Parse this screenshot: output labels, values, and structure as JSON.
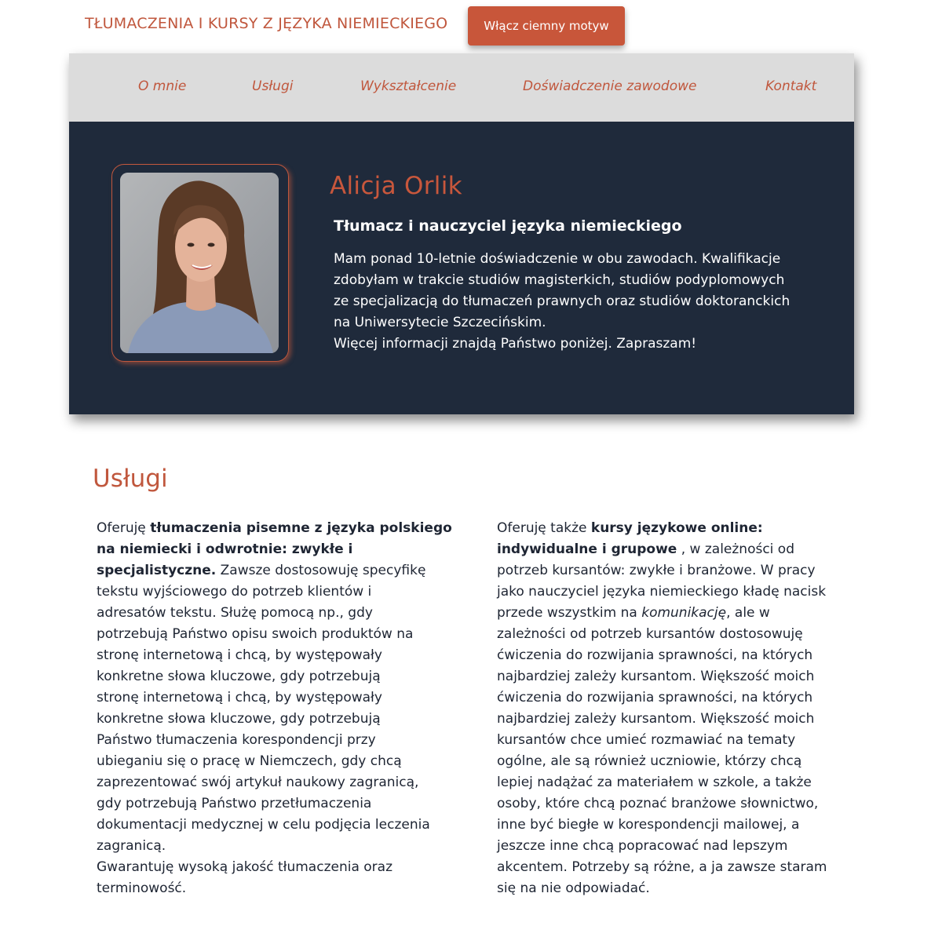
{
  "header": {
    "site_title": "TŁUMACZENIA I KURSY Z JĘZYKA NIEMIECKIEGO",
    "theme_button": "Włącz ciemny motyw"
  },
  "nav": {
    "items": [
      {
        "label": "O mnie"
      },
      {
        "label": "Usługi"
      },
      {
        "label": "Wykształcenie"
      },
      {
        "label": "Doświadczenie zawodowe"
      },
      {
        "label": "Kontakt"
      }
    ]
  },
  "hero": {
    "name": "Alicja Orlik",
    "role": "Tłumacz i nauczyciel języka niemieckiego",
    "lines": [
      "Mam ponad 10-letnie doświadczenie w obu zawodach. Kwalifikacje",
      "zdobyłam w trakcie studiów magisterkich, studiów podyplomowych",
      "ze specjalizacją do tłumaczeń prawnych oraz studiów doktoranckich",
      "na Uniwersytecie Szczecińskim.",
      "Więcej informacji znajdą Państwo poniżej. Zapraszam!"
    ]
  },
  "services": {
    "title": "Usługi",
    "left": {
      "l1_a": "Oferuję ",
      "l1_b": "tłumaczenia pisemne z języka polskiego",
      "l2": "na niemiecki i odwrotnie: zwykłe i",
      "l3_a": "specjalistyczne.",
      "l3_b": " Zawsze dostosowuję specyfikę",
      "rest": [
        "tekstu wyjściowego do potrzeb klientów i",
        "adresatów tekstu. Służę pomocą np., gdy",
        "potrzebują Państwo opisu swoich produktów na",
        "stronę internetową i chcą, by występowały",
        "konkretne słowa kluczowe, gdy potrzebują",
        "stronę internetową i chcą, by występowały",
        "konkretne słowa kluczowe, gdy potrzebują",
        "Państwo tłumaczenia korespondencji przy",
        "ubieganiu się o pracę w Niemczech, gdy chcą",
        "zaprezentować swój artykuł naukowy zagranicą,",
        "gdy potrzebują Państwo przetłumaczenia",
        "dokumentacji medycznej w celu podjęcia leczenia",
        "zagranicą.",
        "Gwarantuję wysoką jakość tłumaczenia oraz",
        "terminowość."
      ]
    },
    "right": {
      "l1_a": "Oferuję także ",
      "l1_b": "kursy językowe online:",
      "l2_a": "indywidualne i grupowe",
      "l2_b": " , w zależności od",
      "l3": "potrzeb kursantów: zwykłe i branżowe. W pracy",
      "l4": "jako nauczyciel języka niemieckiego kładę nacisk",
      "l5_a": "przede wszystkim na ",
      "l5_b": "komunikację",
      "l5_c": ", ale w",
      "rest": [
        "zależności od potrzeb kursantów dostosowuję",
        "ćwiczenia do rozwijania sprawności, na których",
        "najbardziej zależy kursantom. Większość moich",
        "ćwiczenia do rozwijania sprawności, na których",
        "najbardziej zależy kursantom. Większość moich",
        "kursantów chce umieć rozmawiać na tematy",
        "ogólne, ale są również uczniowie, którzy chcą",
        "lepiej nadążać za materiałem w szkole, a także",
        "osoby, które chcą poznać branżowe słownictwo,",
        "inne być biegłe w korespondencji mailowej, a",
        "jeszcze inne chcą popracować nad lepszym",
        "akcentem. Potrzeby są różne, a ja zawsze staram",
        "się na nie odpowiadać."
      ]
    }
  },
  "colors": {
    "accent": "#c0573d",
    "button": "#c8563a",
    "hero_bg": "#1f2a3b",
    "nav_bg": "#dcdcdc",
    "text": "#1e2533"
  }
}
